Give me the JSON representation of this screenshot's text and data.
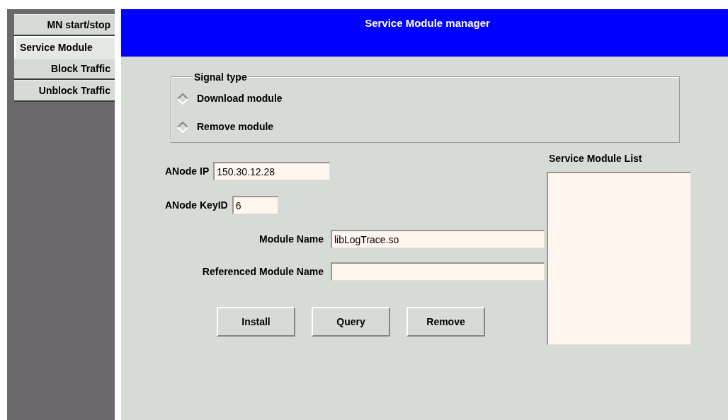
{
  "sidebar": {
    "items": [
      {
        "label": "MN start/stop",
        "selected": false
      },
      {
        "label": "Service Module",
        "selected": true
      },
      {
        "label": "Block Traffic",
        "selected": false
      },
      {
        "label": "Unblock Traffic",
        "selected": false
      }
    ]
  },
  "header": {
    "title": "Service Module manager"
  },
  "signal_type": {
    "legend": "Signal type",
    "options": [
      {
        "label": "Download module",
        "selected": false
      },
      {
        "label": "Remove module",
        "selected": false
      }
    ]
  },
  "fields": {
    "anode_ip": {
      "label": "ANode IP",
      "value": "150.30.12.28"
    },
    "anode_keyid": {
      "label": "ANode KeyID",
      "value": "6"
    },
    "module_name": {
      "label": "Module Name",
      "value": "libLogTrace.so"
    },
    "referenced_module_name": {
      "label": "Referenced Module Name"
    }
  },
  "buttons": [
    "Install",
    "Query",
    "Remove"
  ],
  "module_list": {
    "label": "Service Module List"
  }
}
